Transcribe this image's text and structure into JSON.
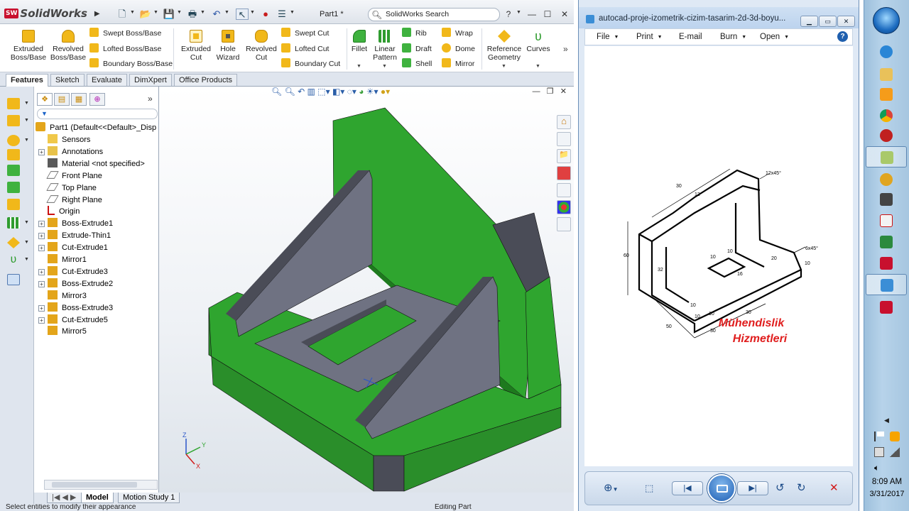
{
  "solidworks": {
    "app_name": "SolidWorks",
    "logo_badge": "SW",
    "document_title": "Part1 *",
    "search_placeholder": "SolidWorks Search",
    "help_label": "?",
    "ribbon": {
      "extruded_boss": "Extruded\nBoss/Base",
      "revolved_boss": "Revolved\nBoss/Base",
      "swept_boss": "Swept Boss/Base",
      "lofted_boss": "Lofted Boss/Base",
      "boundary_boss": "Boundary Boss/Base",
      "extruded_cut": "Extruded\nCut",
      "hole_wizard": "Hole\nWizard",
      "revolved_cut": "Revolved\nCut",
      "swept_cut": "Swept Cut",
      "lofted_cut": "Lofted Cut",
      "boundary_cut": "Boundary Cut",
      "fillet": "Fillet",
      "linear_pattern": "Linear\nPattern",
      "rib": "Rib",
      "draft": "Draft",
      "shell": "Shell",
      "wrap": "Wrap",
      "dome": "Dome",
      "mirror": "Mirror",
      "reference_geometry": "Reference\nGeometry",
      "curves": "Curves"
    },
    "command_tabs": [
      "Features",
      "Sketch",
      "Evaluate",
      "DimXpert",
      "Office Products"
    ],
    "active_tab": "Features",
    "tree_root": "Part1  (Default<<Default>_Disp",
    "tree": [
      {
        "label": "Sensors",
        "expandable": false,
        "icon": "sensor-icon"
      },
      {
        "label": "Annotations",
        "expandable": true,
        "icon": "annotation-icon"
      },
      {
        "label": "Material <not specified>",
        "expandable": false,
        "icon": "material-icon"
      },
      {
        "label": "Front Plane",
        "expandable": false,
        "icon": "plane-icon"
      },
      {
        "label": "Top Plane",
        "expandable": false,
        "icon": "plane-icon"
      },
      {
        "label": "Right Plane",
        "expandable": false,
        "icon": "plane-icon"
      },
      {
        "label": "Origin",
        "expandable": false,
        "icon": "origin-icon"
      },
      {
        "label": "Boss-Extrude1",
        "expandable": true,
        "icon": "extrude-icon"
      },
      {
        "label": "Extrude-Thin1",
        "expandable": true,
        "icon": "extrude-icon"
      },
      {
        "label": "Cut-Extrude1",
        "expandable": true,
        "icon": "cut-icon"
      },
      {
        "label": "Mirror1",
        "expandable": false,
        "icon": "mirror-icon"
      },
      {
        "label": "Cut-Extrude3",
        "expandable": true,
        "icon": "cut-icon"
      },
      {
        "label": "Boss-Extrude2",
        "expandable": true,
        "icon": "extrude-icon"
      },
      {
        "label": "Mirror3",
        "expandable": false,
        "icon": "mirror-icon"
      },
      {
        "label": "Boss-Extrude3",
        "expandable": true,
        "icon": "extrude-icon"
      },
      {
        "label": "Cut-Extrude5",
        "expandable": true,
        "icon": "cut-icon"
      },
      {
        "label": "Mirror5",
        "expandable": false,
        "icon": "mirror-icon"
      }
    ],
    "bottom_tabs": [
      "Model",
      "Motion Study 1"
    ],
    "status_left": "Select entities to modify their appearance",
    "status_right": "Editing Part",
    "triad": {
      "x": "X",
      "y": "Y",
      "z": "Z"
    },
    "colors": {
      "model_green": "#2fa52f",
      "model_gray": "#6f7282",
      "model_dark": "#4a4c57"
    }
  },
  "photo_viewer": {
    "title": "autocad-proje-izometrik-cizim-tasarim-2d-3d-boyu...",
    "menus": [
      "File",
      "Print",
      "E-mail",
      "Burn",
      "Open"
    ],
    "help": "?",
    "watermark_line1": "Mühendislik",
    "watermark_line2": "Hizmetleri",
    "dims": {
      "d1": "30",
      "d2": "12",
      "d3": "12x45°",
      "d4": "6x45°",
      "d5": "60",
      "d6": "32",
      "d7": "10",
      "d8": "10",
      "d9": "16",
      "d10": "20",
      "d11": "10",
      "d12": "10",
      "d13": "50",
      "d14": "30",
      "d15": "30",
      "d16": "10",
      "d17": "10"
    }
  },
  "taskbar": {
    "time": "8:09 AM",
    "date": "3/31/2017"
  }
}
